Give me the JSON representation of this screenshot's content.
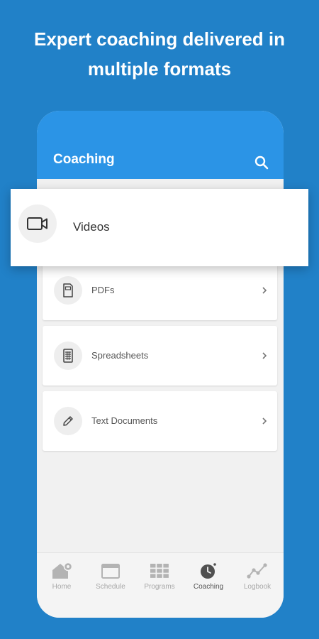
{
  "headline": {
    "line1": "Expert coaching delivered in",
    "line2": "multiple formats"
  },
  "appbar": {
    "title": "Coaching",
    "search_icon": "search-icon"
  },
  "featured": {
    "label": "Videos",
    "icon": "video-camera-icon"
  },
  "items": [
    {
      "label": "PDFs",
      "icon": "pdf-document-icon"
    },
    {
      "label": "Spreadsheets",
      "icon": "spreadsheet-icon"
    },
    {
      "label": "Text Documents",
      "icon": "pencil-icon"
    }
  ],
  "tabs": [
    {
      "label": "Home",
      "icon": "home-icon",
      "active": false
    },
    {
      "label": "Schedule",
      "icon": "calendar-icon",
      "active": false
    },
    {
      "label": "Programs",
      "icon": "grid-icon",
      "active": false
    },
    {
      "label": "Coaching",
      "icon": "clock-icon",
      "active": true
    },
    {
      "label": "Logbook",
      "icon": "chart-line-icon",
      "active": false
    }
  ],
  "colors": {
    "background": "#2181c8",
    "appbar": "#2b94e6",
    "screen": "#f1f1f1"
  }
}
